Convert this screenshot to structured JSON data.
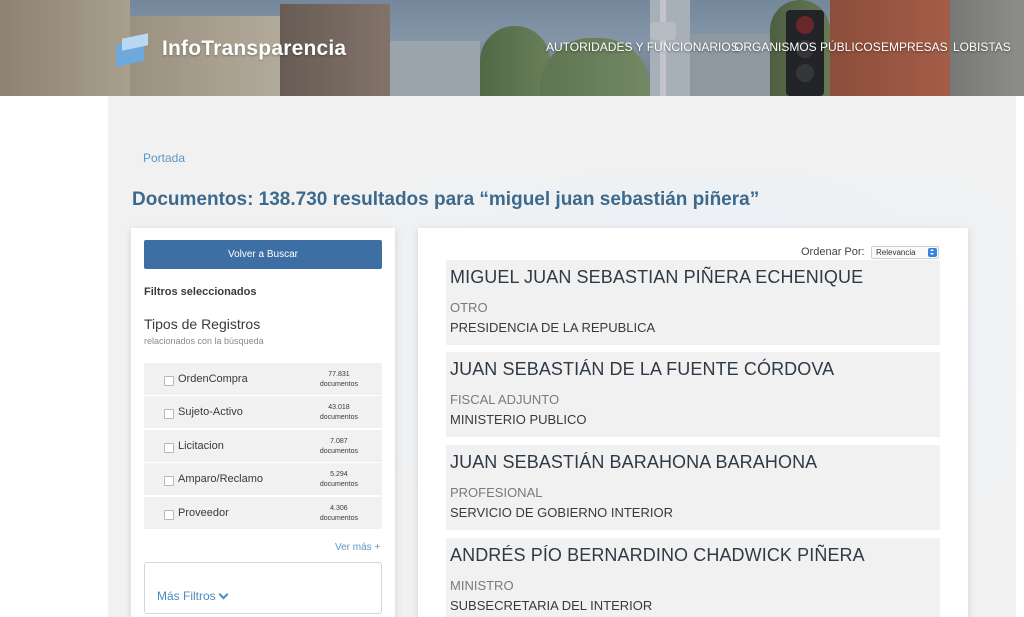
{
  "header": {
    "logo_text": "InfoTransparencia",
    "nav": [
      {
        "label": "AUTORIDADES Y FUNCIONARIOS"
      },
      {
        "label": "ORGANISMOS PÚBLICOS"
      },
      {
        "label": "EMPRESAS"
      },
      {
        "label": "LOBISTAS"
      }
    ]
  },
  "breadcrumb": "Portada",
  "page_title": "Documentos: 138.730 resultados para “miguel juan sebastián piñera”",
  "filters": {
    "back_button": "Volver a Buscar",
    "selected_title": "Filtros seleccionados",
    "types_title": "Tipos de Registros",
    "types_subtitle": "relacionados con la búsqueda",
    "types": [
      {
        "label": "OrdenCompra",
        "count": "77.831",
        "unit": "documentos"
      },
      {
        "label": "Sujeto-Activo",
        "count": "43.018",
        "unit": "documentos"
      },
      {
        "label": "Licitacion",
        "count": "7.087",
        "unit": "documentos"
      },
      {
        "label": "Amparo/Reclamo",
        "count": "5.294",
        "unit": "documentos"
      },
      {
        "label": "Proveedor",
        "count": "4.306",
        "unit": "documentos"
      }
    ],
    "see_more": "Ver más +",
    "more_filters": "Más Filtros"
  },
  "results": {
    "order_label": "Ordenar Por:",
    "order_value": "Relevancia",
    "items": [
      {
        "name": "MIGUEL JUAN SEBASTIAN PIÑERA ECHENIQUE",
        "role": "OTRO",
        "org": "PRESIDENCIA DE LA REPUBLICA"
      },
      {
        "name": "JUAN SEBASTIÁN DE LA FUENTE CÓRDOVA",
        "role": "FISCAL ADJUNTO",
        "org": "MINISTERIO PUBLICO"
      },
      {
        "name": "JUAN SEBASTIÁN BARAHONA BARAHONA",
        "role": "PROFESIONAL",
        "org": "SERVICIO DE GOBIERNO INTERIOR"
      },
      {
        "name": "ANDRÉS PÍO BERNARDINO CHADWICK PIÑERA",
        "role": "MINISTRO",
        "org": "SUBSECRETARIA DEL INTERIOR"
      }
    ]
  },
  "colors": {
    "primary_button": "#3e6fa4",
    "title": "#3d6a8c",
    "link": "#5c97c4"
  }
}
